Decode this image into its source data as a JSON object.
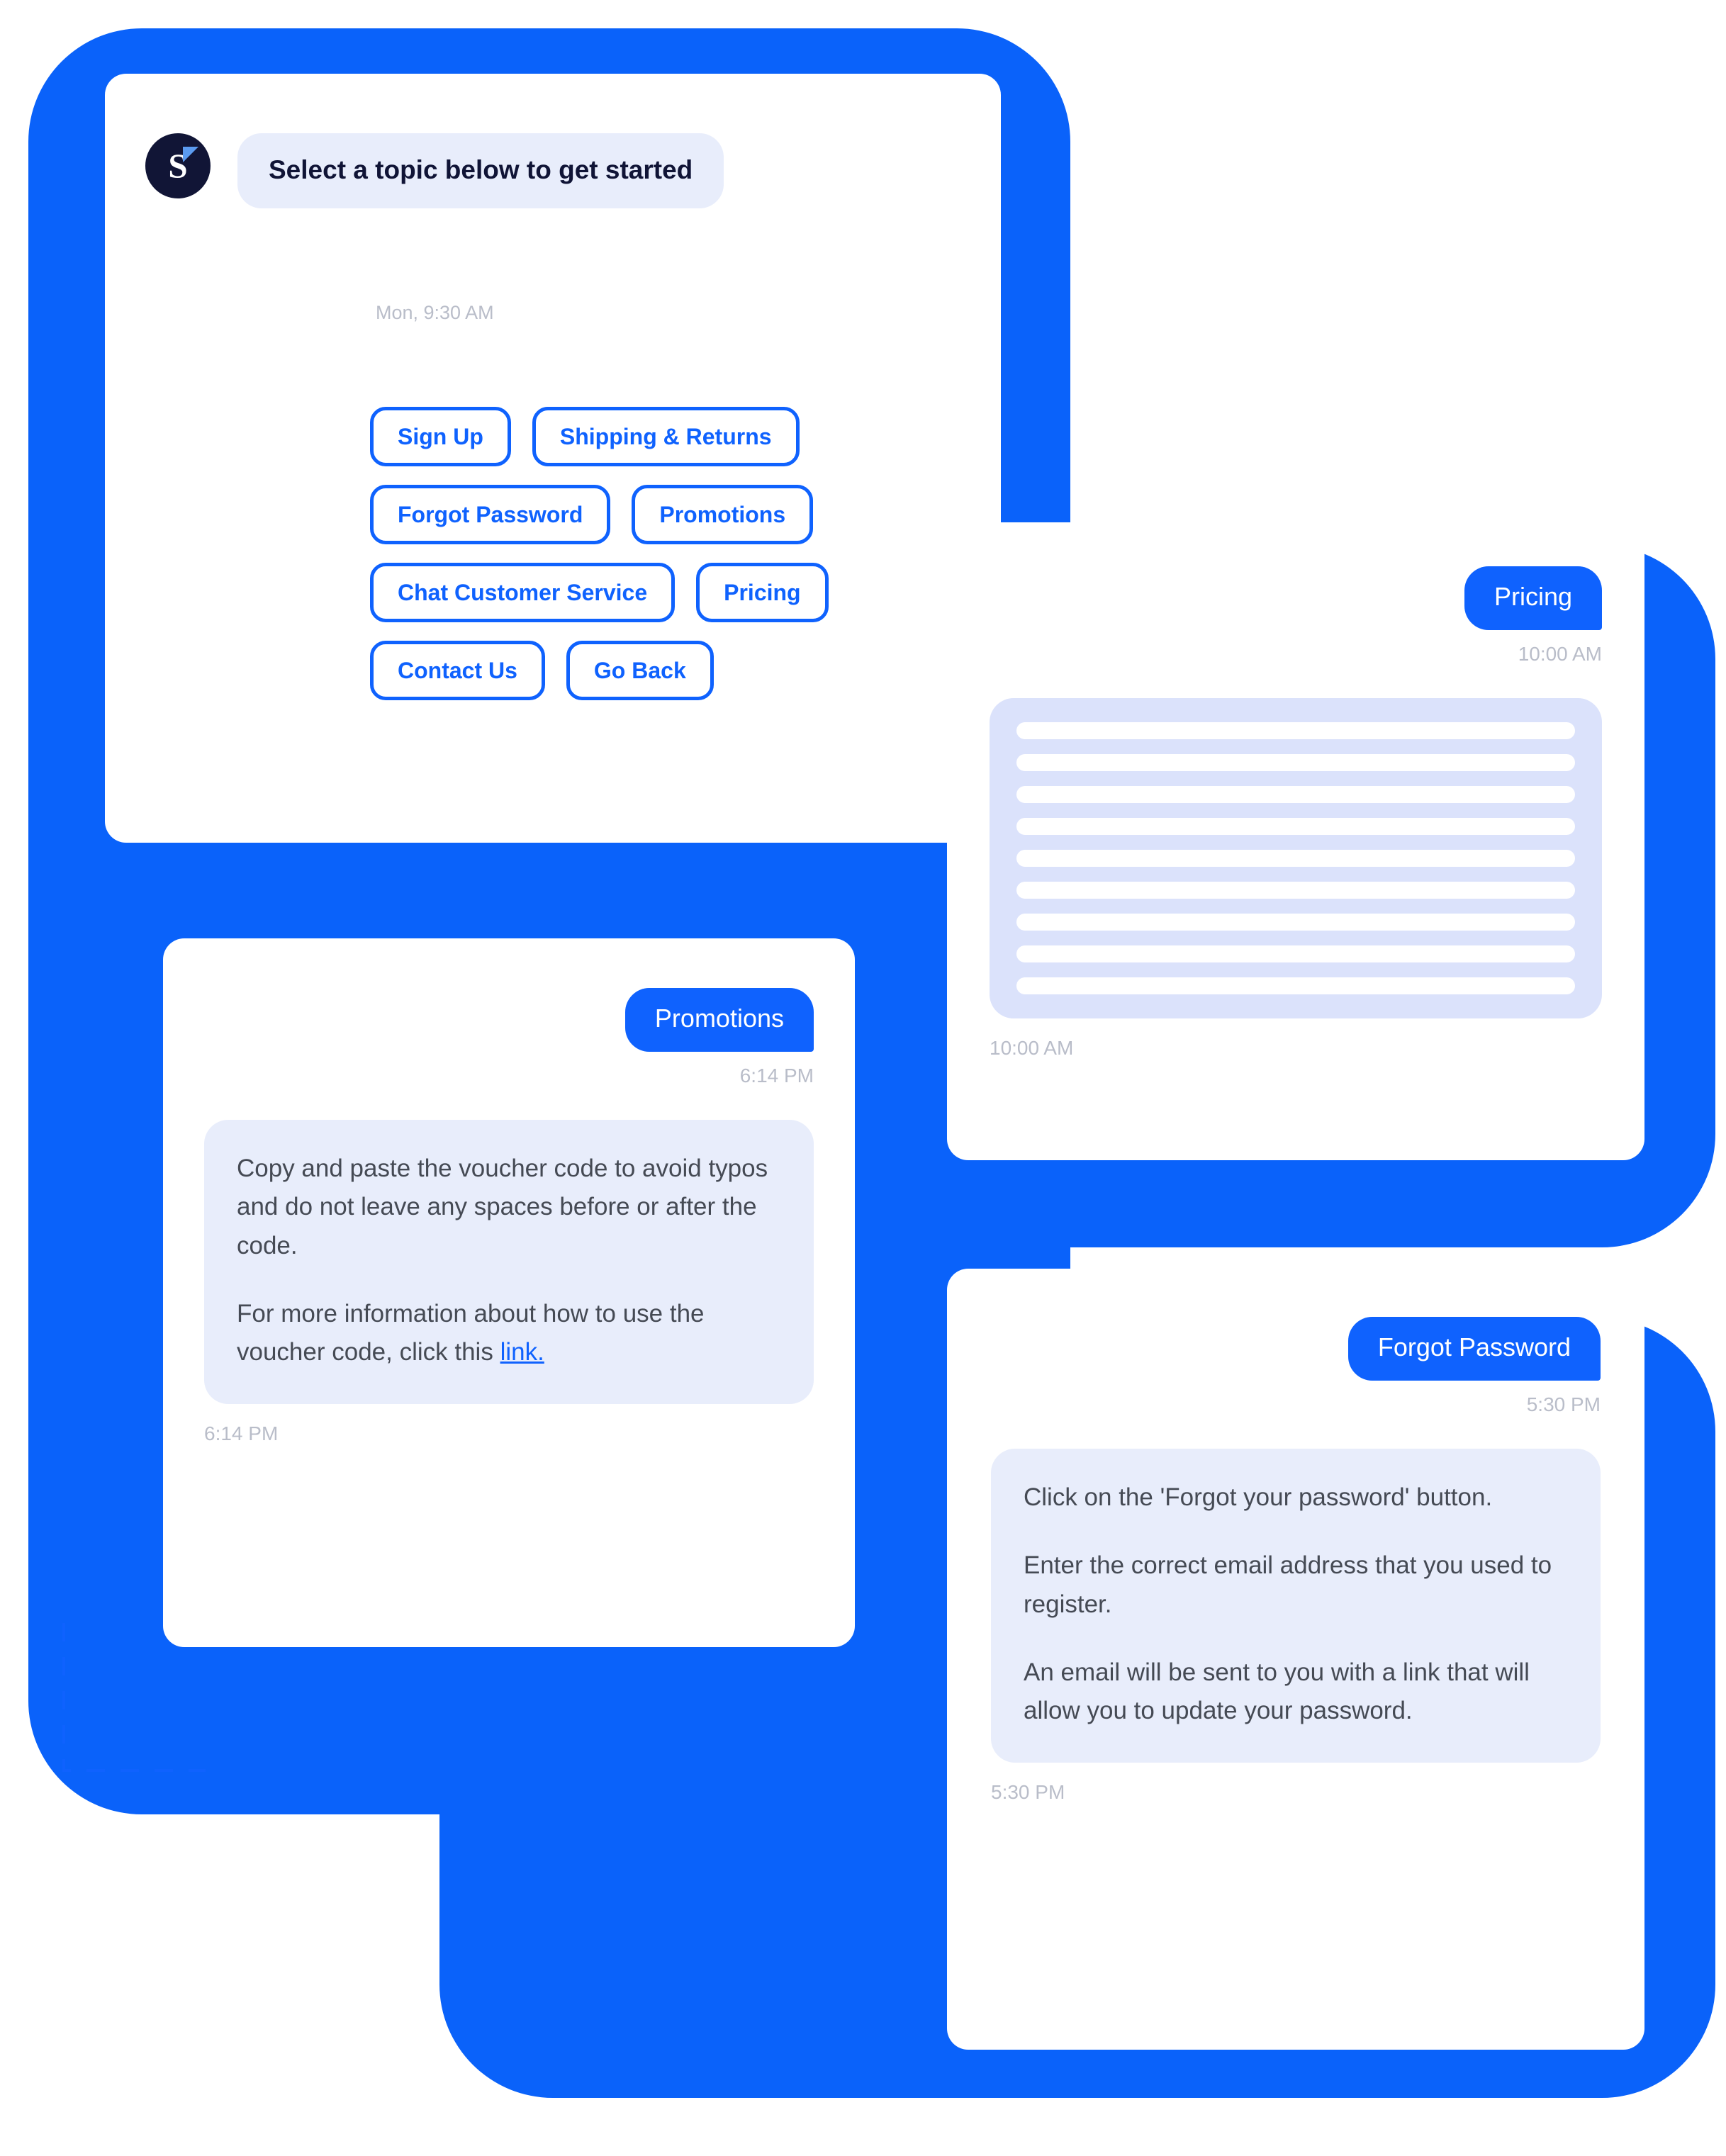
{
  "theme": {
    "brand_blue": "#0f62fe",
    "bubble_grey": "#e8edfb",
    "skeleton_bubble": "#dbe2fb",
    "avatar_navy": "#111536",
    "avatar_accent": "#5b9bf0",
    "timestamp_grey": "#b9bdc9",
    "body_text": "#454a54"
  },
  "topic_card": {
    "avatar": {
      "letter": "S",
      "icon": "brand-logo-icon"
    },
    "greeting": "Select a topic below to get started",
    "timestamp": "Mon, 9:30 AM",
    "topic_rows": [
      [
        "Sign Up",
        "Shipping & Returns"
      ],
      [
        "Forgot Password",
        "Promotions"
      ],
      [
        "Chat Customer Service",
        "Pricing"
      ],
      [
        "Contact Us",
        "Go Back"
      ]
    ]
  },
  "pricing_card": {
    "sent_label": "Pricing",
    "sent_time": "10:00 AM",
    "reply_time": "10:00 AM",
    "skeleton_line_count": 9
  },
  "promotions_card": {
    "sent_label": "Promotions",
    "sent_time": "6:14 PM",
    "reply_paragraph_1": "Copy and paste the voucher code to avoid typos and do not leave any spaces before or after the code.",
    "reply_paragraph_2_before_link": "For more information about how to use the voucher code, click this ",
    "reply_link_text": "link.",
    "reply_time": "6:14 PM"
  },
  "forgot_card": {
    "sent_label": "Forgot Password",
    "sent_time": "5:30 PM",
    "reply_paragraph_1": "Click on the 'Forgot your password' button.",
    "reply_paragraph_2": "Enter the correct email address that you used to register.",
    "reply_paragraph_3": "An email will be sent to you with a link that will allow you to update your password.",
    "reply_time": "5:30 PM"
  }
}
